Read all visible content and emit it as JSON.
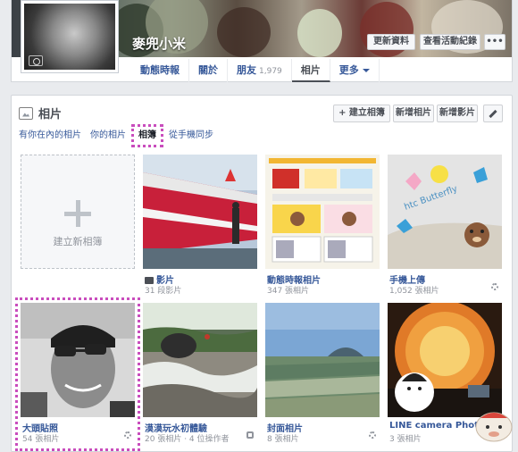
{
  "profile": {
    "name": "麥兜小米",
    "update_info": "更新資料",
    "view_activity": "查看活動紀錄",
    "more_dots": "•••"
  },
  "nav": {
    "items": [
      {
        "label": "動態時報"
      },
      {
        "label": "關於"
      },
      {
        "label": "朋友",
        "count": "1,979"
      },
      {
        "label": "相片"
      },
      {
        "label": "更多"
      }
    ]
  },
  "photos": {
    "title": "相片",
    "create_album": "+ 建立相簿",
    "add_photos": "新增相片",
    "add_video": "新增影片",
    "tabs": [
      "有你在內的相片",
      "你的相片",
      "相簿",
      "從手機同步"
    ],
    "create_new_album": "建立新相簿",
    "albums": [
      {
        "title": "影片",
        "count": "31 段影片"
      },
      {
        "title": "動態時報相片",
        "count": "347 張相片"
      },
      {
        "title": "手機上傳",
        "count": "1,052 張相片"
      },
      {
        "title": "大頭貼照",
        "count": "54 張相片"
      },
      {
        "title": "漠漠玩水初體驗",
        "count": "20 張相片",
        "extra": "4 位操作者"
      },
      {
        "title": "封面相片",
        "count": "8 張相片"
      },
      {
        "title": "LINE camera Photos",
        "count": "3 張相片"
      }
    ]
  },
  "colors": {
    "highlight": "#c94dbd",
    "link": "#365899",
    "bg": "#e9ebee"
  }
}
